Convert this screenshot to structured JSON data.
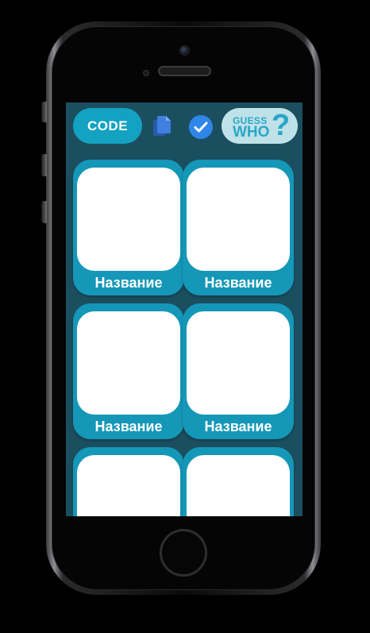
{
  "app": {
    "code_button_label": "CODE",
    "guess_logo": {
      "line1": "GUESS",
      "line2": "WHO",
      "mark": "?"
    },
    "icons": [
      "copy-icon",
      "check-circle-icon"
    ],
    "colors": {
      "background": "#1b4f60",
      "accent": "#13a2c2",
      "card": "#1597b8",
      "check": "#2f86e8",
      "logo_bg": "#bfe1e8"
    }
  },
  "cards": [
    {
      "label": "Название"
    },
    {
      "label": "Название"
    },
    {
      "label": "Название"
    },
    {
      "label": "Название"
    },
    {
      "label": ""
    },
    {
      "label": ""
    }
  ]
}
